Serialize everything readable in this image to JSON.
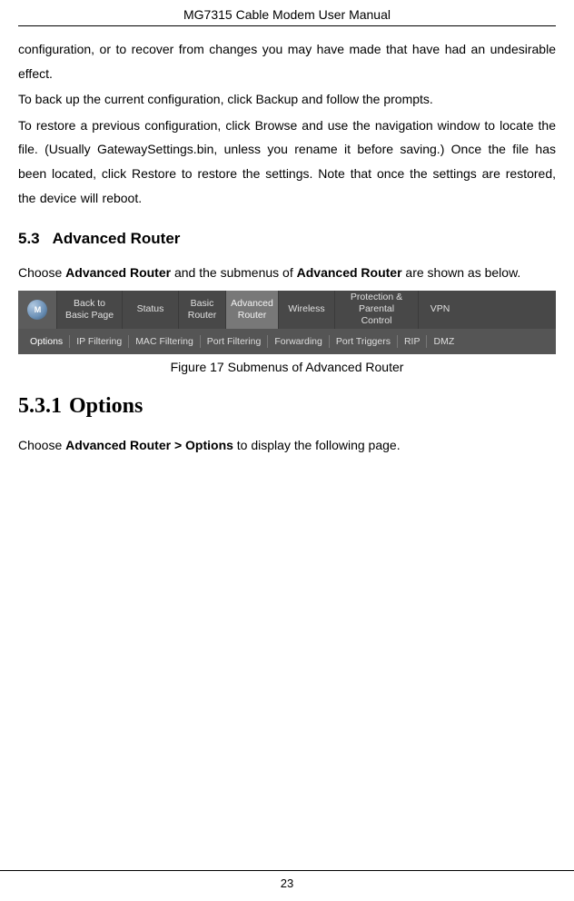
{
  "header": {
    "title": "MG7315 Cable Modem User Manual"
  },
  "body": {
    "p1": "configuration, or to recover from changes you may have made that have had an undesirable effect.",
    "p2": "To back up the current configuration, click Backup and follow the prompts.",
    "p3": "To restore a previous configuration, click Browse and use the navigation window to locate the file.  (Usually GatewaySettings.bin,  unless you rename it before saving.)  Once the file has been located, click Restore to restore the settings.  Note that once the settings are restored, the device will reboot."
  },
  "section53": {
    "num": "5.3",
    "title": "Advanced Router",
    "intro_pre": "Choose ",
    "intro_b1": "Advanced Router",
    "intro_mid": " and the submenus of ",
    "intro_b2": "Advanced Router",
    "intro_post": " are shown as below."
  },
  "figure": {
    "caption": "Figure 17 Submenus of Advanced Router",
    "nav_top": {
      "back": "Back to\nBasic Page",
      "status": "Status",
      "basic": "Basic\nRouter",
      "advanced": "Advanced\nRouter",
      "wireless": "Wireless",
      "protection": "Protection &\nParental Control",
      "vpn": "VPN"
    },
    "subnav": [
      "Options",
      "IP Filtering",
      "MAC Filtering",
      "Port Filtering",
      "Forwarding",
      "Port Triggers",
      "RIP",
      "DMZ"
    ]
  },
  "section531": {
    "num": "5.3.1",
    "title": "Options",
    "intro_pre": "Choose ",
    "intro_b": "Advanced Router > Options",
    "intro_post": " to display the following page."
  },
  "footer": {
    "page": "23"
  }
}
